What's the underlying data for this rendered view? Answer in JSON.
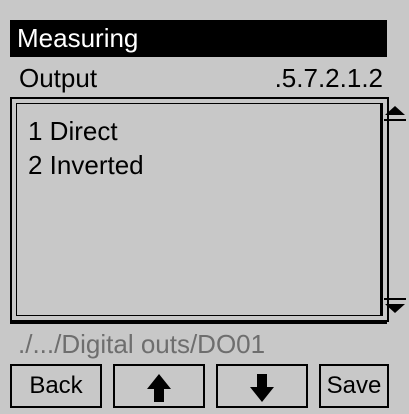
{
  "window": {
    "title": "Measuring"
  },
  "header": {
    "section": "Output",
    "code": ".5.7.2.1.2"
  },
  "options": {
    "items": [
      {
        "label": "1 Direct"
      },
      {
        "label": "2 Inverted"
      }
    ]
  },
  "footer": {
    "path": "./.../Digital outs/DO01"
  },
  "buttons": {
    "back_label": "Back",
    "up_icon": "arrow-up-icon",
    "down_icon": "arrow-down-icon",
    "save_label": "Save"
  },
  "colors": {
    "background": "#c8c8c8",
    "title_bar": "#000000",
    "title_text": "#ffffff",
    "path_text": "#6e6e6e"
  }
}
